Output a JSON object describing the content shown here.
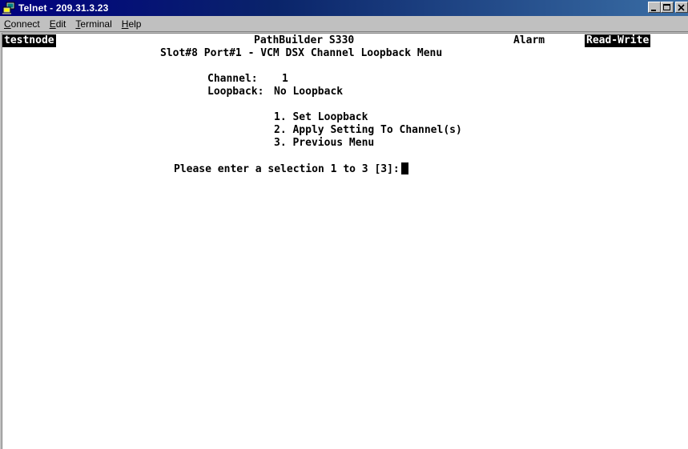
{
  "window": {
    "title": "Telnet - 209.31.3.23",
    "icon": "telnet-computer-icon",
    "controls": [
      "minimize-icon",
      "maximize-icon",
      "close-icon"
    ]
  },
  "menubar": {
    "items": [
      {
        "accel": "C",
        "rest": "onnect"
      },
      {
        "accel": "E",
        "rest": "dit"
      },
      {
        "accel": "T",
        "rest": "erminal"
      },
      {
        "accel": "H",
        "rest": "elp"
      }
    ]
  },
  "terminal": {
    "node_name": "testnode",
    "product": "PathBuilder S330",
    "alarm": "Alarm",
    "access_mode": "Read-Write",
    "menu_title": "Slot#8 Port#1 - VCM DSX Channel Loopback Menu",
    "channel_label": "Channel:",
    "channel_value": "1",
    "loopback_label": "Loopback:",
    "loopback_value": "No Loopback",
    "options": [
      "1. Set Loopback",
      "2. Apply Setting To Channel(s)",
      "3. Previous Menu"
    ],
    "prompt": "Please enter a selection 1 to 3 [3]:"
  }
}
